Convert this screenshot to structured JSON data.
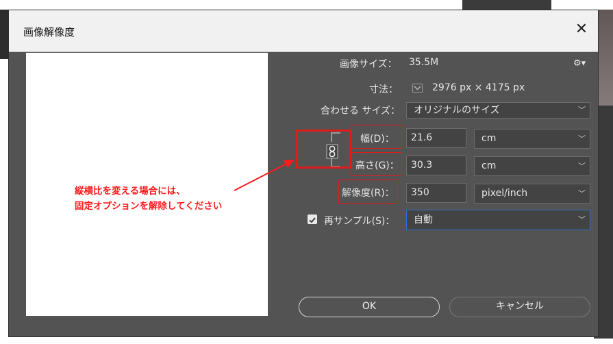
{
  "dialog": {
    "title": "画像解像度",
    "close_icon": "close-icon"
  },
  "image_size": {
    "label": "画像サイズ：",
    "value": "35.5M"
  },
  "dimensions": {
    "label": "寸法：",
    "value": "2976 px × 4175 px"
  },
  "fit_to": {
    "label": "合わせる サイズ：",
    "selected": "オリジナルのサイズ"
  },
  "width": {
    "label": "幅(D)：",
    "value": "21.6",
    "unit": "cm"
  },
  "height": {
    "label": "高さ(G)：",
    "value": "30.3",
    "unit": "cm"
  },
  "resolution": {
    "label": "解像度(R)：",
    "value": "350",
    "unit": "pixel/inch"
  },
  "resample": {
    "label": "再サンプル(S)：",
    "checked": true,
    "selected": "自動"
  },
  "buttons": {
    "ok": "OK",
    "cancel": "キャンセル"
  },
  "annotation": {
    "line1": "縦横比を変える場合には、",
    "line2": "固定オプションを解除してください",
    "color": "#ff1a1a"
  },
  "icons": [
    "gear-icon",
    "chain-link-icon",
    "chevron-down-icon",
    "checkmark-icon"
  ]
}
